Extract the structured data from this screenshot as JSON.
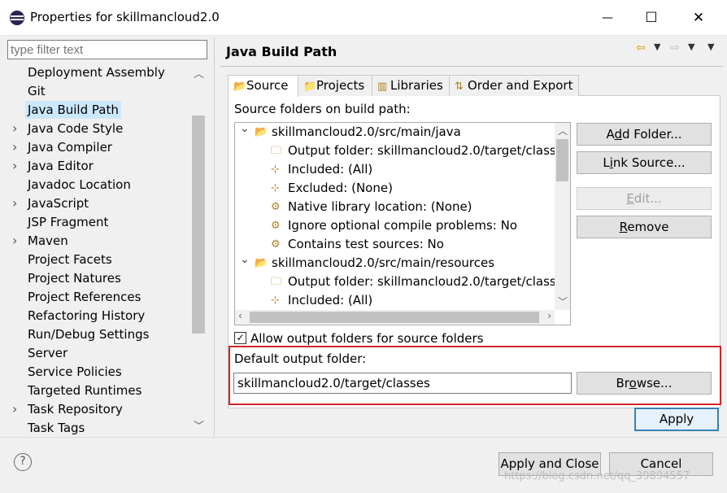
{
  "window": {
    "title": "Properties for skillmancloud2.0",
    "minimize_glyph": "—",
    "maximize_glyph": "☐",
    "close_glyph": "✕"
  },
  "filter": {
    "placeholder": "type filter text"
  },
  "nav_tree": {
    "items": [
      {
        "label": "Deployment Assembly",
        "expandable": false,
        "selected": false
      },
      {
        "label": "Git",
        "expandable": false,
        "selected": false
      },
      {
        "label": "Java Build Path",
        "expandable": false,
        "selected": true
      },
      {
        "label": "Java Code Style",
        "expandable": true,
        "selected": false
      },
      {
        "label": "Java Compiler",
        "expandable": true,
        "selected": false
      },
      {
        "label": "Java Editor",
        "expandable": true,
        "selected": false
      },
      {
        "label": "Javadoc Location",
        "expandable": false,
        "selected": false
      },
      {
        "label": "JavaScript",
        "expandable": true,
        "selected": false
      },
      {
        "label": "JSP Fragment",
        "expandable": false,
        "selected": false
      },
      {
        "label": "Maven",
        "expandable": true,
        "selected": false
      },
      {
        "label": "Project Facets",
        "expandable": false,
        "selected": false
      },
      {
        "label": "Project Natures",
        "expandable": false,
        "selected": false
      },
      {
        "label": "Project References",
        "expandable": false,
        "selected": false
      },
      {
        "label": "Refactoring History",
        "expandable": false,
        "selected": false
      },
      {
        "label": "Run/Debug Settings",
        "expandable": false,
        "selected": false
      },
      {
        "label": "Server",
        "expandable": false,
        "selected": false
      },
      {
        "label": "Service Policies",
        "expandable": false,
        "selected": false
      },
      {
        "label": "Targeted Runtimes",
        "expandable": false,
        "selected": false
      },
      {
        "label": "Task Repository",
        "expandable": true,
        "selected": false
      },
      {
        "label": "Task Tags",
        "expandable": false,
        "selected": false
      }
    ]
  },
  "page": {
    "title": "Java Build Path",
    "tabs": [
      {
        "label": "Source",
        "active": true,
        "icon": "source-folder-icon"
      },
      {
        "label": "Projects",
        "active": false,
        "icon": "projects-icon"
      },
      {
        "label": "Libraries",
        "active": false,
        "icon": "libraries-icon"
      },
      {
        "label": "Order and Export",
        "active": false,
        "icon": "order-export-icon"
      }
    ],
    "source_label": "Source folders on build path:",
    "source_tree": [
      {
        "level": 0,
        "text": "skillmancloud2.0/src/main/java",
        "icon": "package-folder-icon",
        "expanded": true
      },
      {
        "level": 1,
        "text": "Output folder: skillmancloud2.0/target/classes",
        "icon": "output-folder-icon"
      },
      {
        "level": 1,
        "text": "Included: (All)",
        "icon": "included-icon"
      },
      {
        "level": 1,
        "text": "Excluded: (None)",
        "icon": "excluded-icon"
      },
      {
        "level": 1,
        "text": "Native library location: (None)",
        "icon": "native-library-icon"
      },
      {
        "level": 1,
        "text": "Ignore optional compile problems: No",
        "icon": "ignore-problems-icon"
      },
      {
        "level": 1,
        "text": "Contains test sources: No",
        "icon": "test-sources-icon"
      },
      {
        "level": 0,
        "text": "skillmancloud2.0/src/main/resources",
        "icon": "package-folder-icon",
        "expanded": true
      },
      {
        "level": 1,
        "text": "Output folder: skillmancloud2.0/target/classes",
        "icon": "output-folder-icon"
      },
      {
        "level": 1,
        "text": "Included: (All)",
        "icon": "included-icon"
      }
    ],
    "buttons": {
      "add_folder_pre": "A",
      "add_folder_mn": "d",
      "add_folder_post": "d Folder...",
      "link_source_pre": "L",
      "link_source_mn": "i",
      "link_source_post": "nk Source...",
      "edit_mn": "E",
      "edit_post": "dit...",
      "remove_mn": "R",
      "remove_post": "emove"
    },
    "allow_output_folders": {
      "label": "Allow output folders for source folders",
      "checked": true
    },
    "default_output": {
      "label": "Default output folder:",
      "value": "skillmancloud2.0/target/classes",
      "browse_pre": "Br",
      "browse_mn": "o",
      "browse_post": "wse..."
    },
    "apply_label": "Apply"
  },
  "footer": {
    "apply_and_close": "Apply and Close",
    "cancel": "Cancel",
    "help_glyph": "?"
  },
  "watermark": "https://blog.csdn.net/qq_39894557",
  "colors": {
    "highlight_box": "#d0242a",
    "selection": "#cce8ff",
    "default_button_border": "#3c7fb1"
  }
}
